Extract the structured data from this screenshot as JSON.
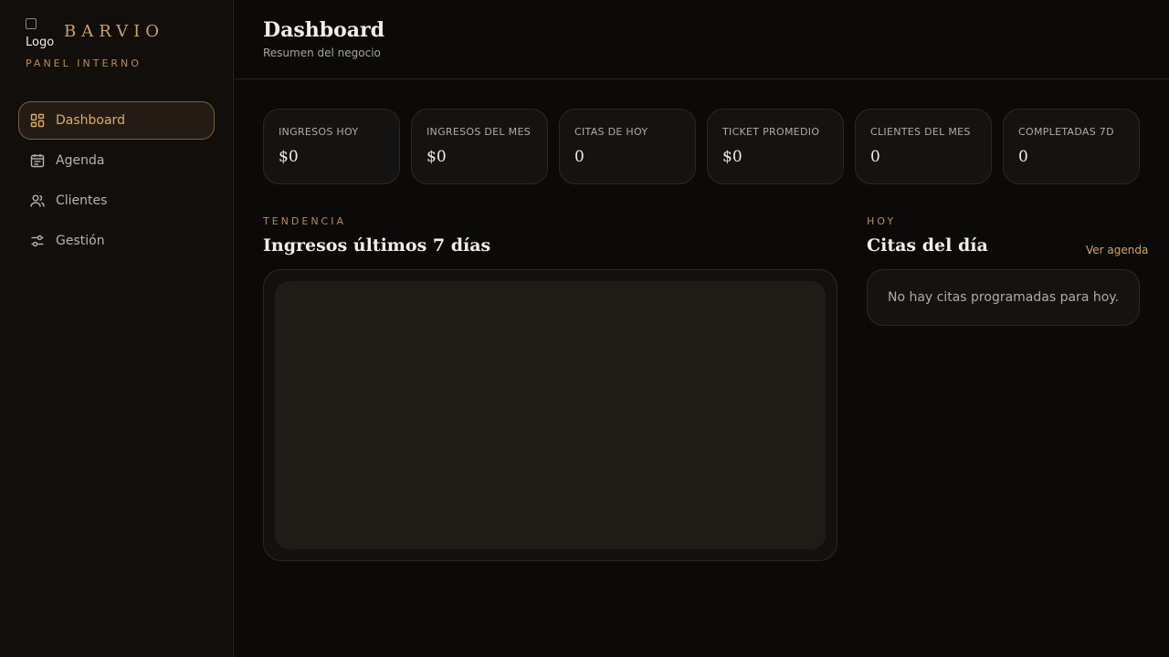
{
  "brand": {
    "logo_alt": "Logo",
    "name": "BARVIO",
    "subtitle": "PANEL INTERNO"
  },
  "sidebar": {
    "items": [
      {
        "label": "Dashboard",
        "icon": "dashboard-grid-icon",
        "active": true
      },
      {
        "label": "Agenda",
        "icon": "calendar-icon",
        "active": false
      },
      {
        "label": "Clientes",
        "icon": "users-icon",
        "active": false
      },
      {
        "label": "Gestión",
        "icon": "sliders-icon",
        "active": false
      }
    ]
  },
  "header": {
    "title": "Dashboard",
    "subtitle": "Resumen del negocio"
  },
  "stats": [
    {
      "label": "INGRESOS HOY",
      "value": "$0"
    },
    {
      "label": "INGRESOS DEL MES",
      "value": "$0"
    },
    {
      "label": "CITAS DE HOY",
      "value": "0"
    },
    {
      "label": "TICKET PROMEDIO",
      "value": "$0"
    },
    {
      "label": "CLIENTES DEL MES",
      "value": "0"
    },
    {
      "label": "COMPLETADAS 7D",
      "value": "0"
    }
  ],
  "trend": {
    "eyebrow": "TENDENCIA",
    "title": "Ingresos últimos 7 días"
  },
  "today": {
    "eyebrow": "HOY",
    "title": "Citas del día",
    "link": "Ver agenda",
    "empty_message": "No hay citas programadas para hoy."
  },
  "colors": {
    "accent": "#c9a06a",
    "background": "#0b0a09",
    "sidebar": "#110e0c"
  }
}
